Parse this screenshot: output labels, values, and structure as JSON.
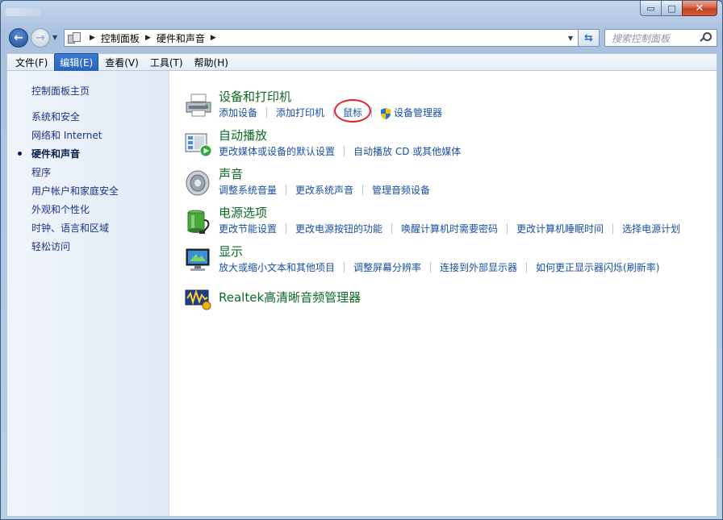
{
  "window": {
    "caption": {
      "minimize": "▭",
      "maximize": "□",
      "close": "✕"
    }
  },
  "address": {
    "crumbs": [
      "控制面板",
      "硬件和声音"
    ],
    "search_placeholder": "搜索控制面板"
  },
  "menu": [
    {
      "label": "文件(F)",
      "active": false
    },
    {
      "label": "编辑(E)",
      "active": true
    },
    {
      "label": "查看(V)",
      "active": false
    },
    {
      "label": "工具(T)",
      "active": false
    },
    {
      "label": "帮助(H)",
      "active": false
    }
  ],
  "sidebar": {
    "home": "控制面板主页",
    "items": [
      {
        "label": "系统和安全"
      },
      {
        "label": "网络和 Internet"
      },
      {
        "label": "硬件和声音",
        "current": true
      },
      {
        "label": "程序"
      },
      {
        "label": "用户帐户和家庭安全"
      },
      {
        "label": "外观和个性化"
      },
      {
        "label": "时钟、语言和区域"
      },
      {
        "label": "轻松访问"
      }
    ]
  },
  "categories": [
    {
      "title": "设备和打印机",
      "icon": "printer-icon",
      "links": [
        "添加设备",
        "添加打印机",
        "鼠标",
        "设备管理器"
      ]
    },
    {
      "title": "自动播放",
      "icon": "autoplay-icon",
      "links": [
        "更改媒体或设备的默认设置",
        "自动播放 CD 或其他媒体"
      ]
    },
    {
      "title": "声音",
      "icon": "speaker-icon",
      "links": [
        "调整系统音量",
        "更改系统声音",
        "管理音频设备"
      ]
    },
    {
      "title": "电源选项",
      "icon": "battery-icon",
      "links": [
        "更改节能设置",
        "更改电源按钮的功能",
        "唤醒计算机时需要密码",
        "更改计算机睡眠时间",
        "选择电源计划"
      ]
    },
    {
      "title": "显示",
      "icon": "monitor-icon",
      "links": [
        "放大或缩小文本和其他项目",
        "调整屏幕分辨率",
        "连接到外部显示器",
        "如何更正显示器闪烁(刷新率)"
      ]
    },
    {
      "title": "Realtek高清晰音频管理器",
      "icon": "realtek-audio-icon",
      "links": []
    }
  ],
  "colors": {
    "category_title": "#0b6b23",
    "link": "#1a4ea3",
    "highlight_ring": "#e0232b"
  }
}
